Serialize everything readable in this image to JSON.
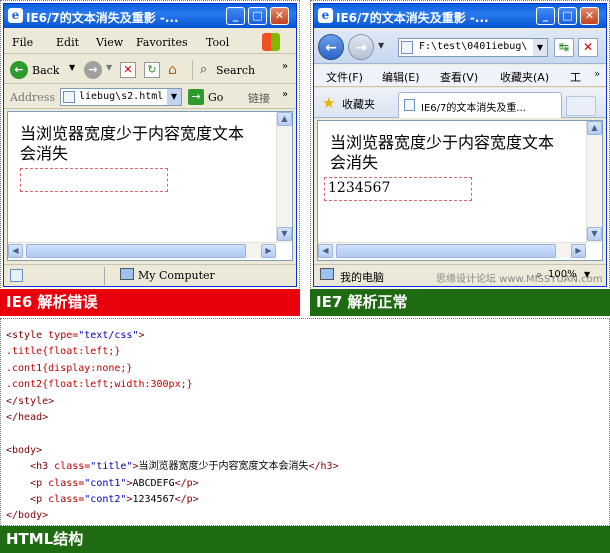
{
  "ie6": {
    "title": "IE6/7的文本消失及重影 -...",
    "menu": [
      "File",
      "Edit",
      "View",
      "Favorites",
      "Tool"
    ],
    "toolbar": {
      "back": "Back",
      "search": "Search"
    },
    "address_label": "Address",
    "address_value": "liebug\\s2.html",
    "go_label": "Go",
    "links_label": "链接",
    "heading": "当浏览器宽度少于内容宽度文本会消失",
    "status_text": "My Computer",
    "caption": "IE6 解析错误"
  },
  "ie7": {
    "title": "IE6/7的文本消失及重影 -...",
    "address_value": "F:\\test\\0401iebug\\",
    "menu": [
      "文件(F)",
      "编辑(E)",
      "查看(V)",
      "收藏夹(A)",
      "工"
    ],
    "favorites_label": "收藏夹",
    "tab_label": "IE6/7的文本消失及重...",
    "heading": "当浏览器宽度少于内容宽度文本会消失",
    "para_text": "1234567",
    "status_text": "我的电脑",
    "zoom": "100%",
    "watermark": "思缘设计论坛 www.MISSYUAN.com",
    "caption": "IE7 解析正常"
  },
  "code": {
    "lines": [
      "<style type=\"text/css\">",
      ".title{float:left;}",
      ".cont1{display:none;}",
      ".cont2{float:left;width:300px;}",
      "</style>",
      "</head>",
      "",
      "<body>",
      "    <h3 class=\"title\">当浏览器宽度少于内容宽度文本会消失</h3>",
      "    <p class=\"cont1\">ABCDEFG</p>",
      "    <p class=\"cont2\">1234567</p>",
      "</body>"
    ],
    "caption": "HTML结构"
  },
  "colors": {
    "ie6_caption_bg": "#e8000c",
    "ie7_caption_bg": "#1e6b12",
    "html_caption_bg": "#1e6b12"
  }
}
